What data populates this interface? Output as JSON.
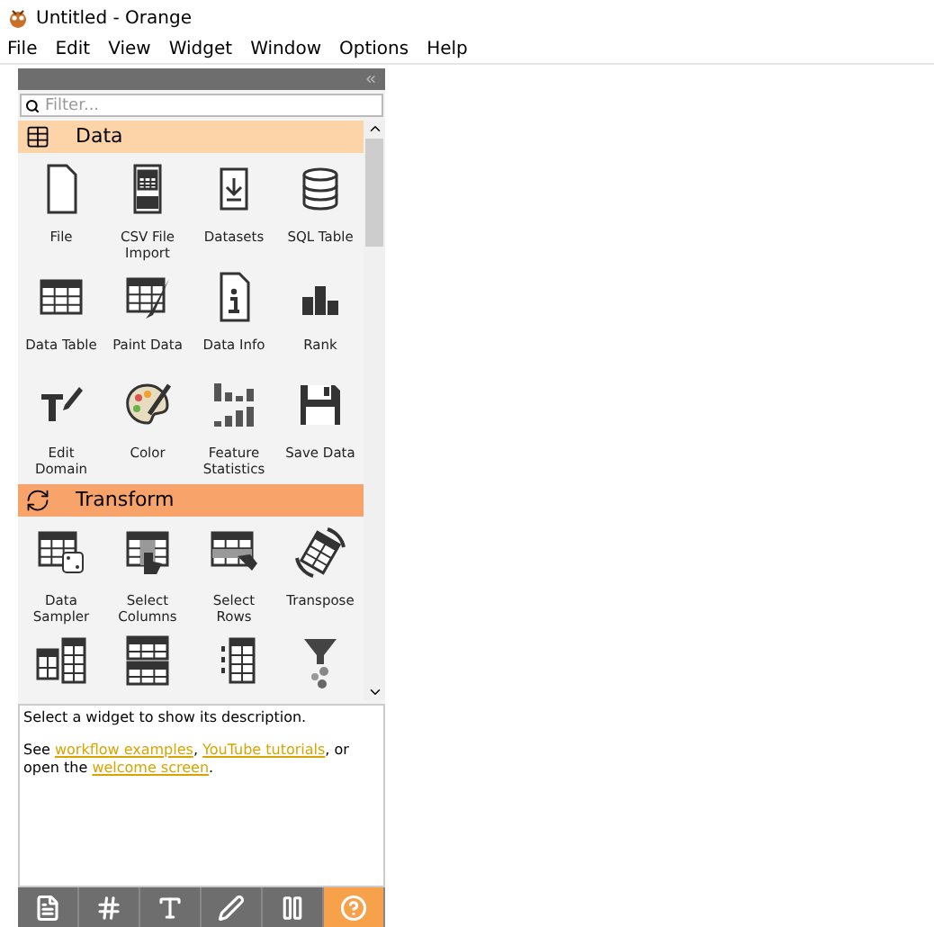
{
  "window": {
    "title": "Untitled  - Orange"
  },
  "menu": [
    "File",
    "Edit",
    "View",
    "Widget",
    "Window",
    "Options",
    "Help"
  ],
  "filter": {
    "placeholder": "Filter..."
  },
  "categories": [
    {
      "name": "Data",
      "kind": "data",
      "color": "#fdd3a8",
      "widgets": [
        {
          "label": "File",
          "kind": "file"
        },
        {
          "label": "CSV File Import",
          "kind": "csv"
        },
        {
          "label": "Datasets",
          "kind": "download"
        },
        {
          "label": "SQL Table",
          "kind": "database"
        },
        {
          "label": "Data Table",
          "kind": "table"
        },
        {
          "label": "Paint Data",
          "kind": "paint"
        },
        {
          "label": "Data Info",
          "kind": "info"
        },
        {
          "label": "Rank",
          "kind": "rank"
        },
        {
          "label": "Edit Domain",
          "kind": "textedit"
        },
        {
          "label": "Color",
          "kind": "palette"
        },
        {
          "label": "Feature Statistics",
          "kind": "bars"
        },
        {
          "label": "Save Data",
          "kind": "save"
        }
      ]
    },
    {
      "name": "Transform",
      "kind": "transform",
      "color": "#f8a36a",
      "widgets": [
        {
          "label": "Data Sampler",
          "kind": "dice"
        },
        {
          "label": "Select Columns",
          "kind": "selcols"
        },
        {
          "label": "Select Rows",
          "kind": "selrows"
        },
        {
          "label": "Transpose",
          "kind": "transpose"
        },
        {
          "kind": "merge"
        },
        {
          "kind": "concat"
        },
        {
          "kind": "split"
        },
        {
          "kind": "funnel"
        }
      ]
    }
  ],
  "description": {
    "text": "Select a widget to show its description.",
    "parts": [
      {
        "kind": "text",
        "text": "See "
      },
      {
        "kind": "link",
        "text": "workflow examples"
      },
      {
        "kind": "text",
        "text": ", "
      },
      {
        "kind": "link",
        "text": "YouTube tutorials"
      },
      {
        "kind": "text",
        "text": ", or open the "
      },
      {
        "kind": "link",
        "text": "welcome screen"
      },
      {
        "kind": "text",
        "text": "."
      }
    ]
  },
  "toolbar": [
    {
      "kind": "info",
      "selected": false
    },
    {
      "kind": "hash",
      "selected": false
    },
    {
      "kind": "text",
      "selected": false
    },
    {
      "kind": "pen",
      "selected": false
    },
    {
      "kind": "pause",
      "selected": false
    },
    {
      "kind": "help",
      "selected": true
    }
  ]
}
